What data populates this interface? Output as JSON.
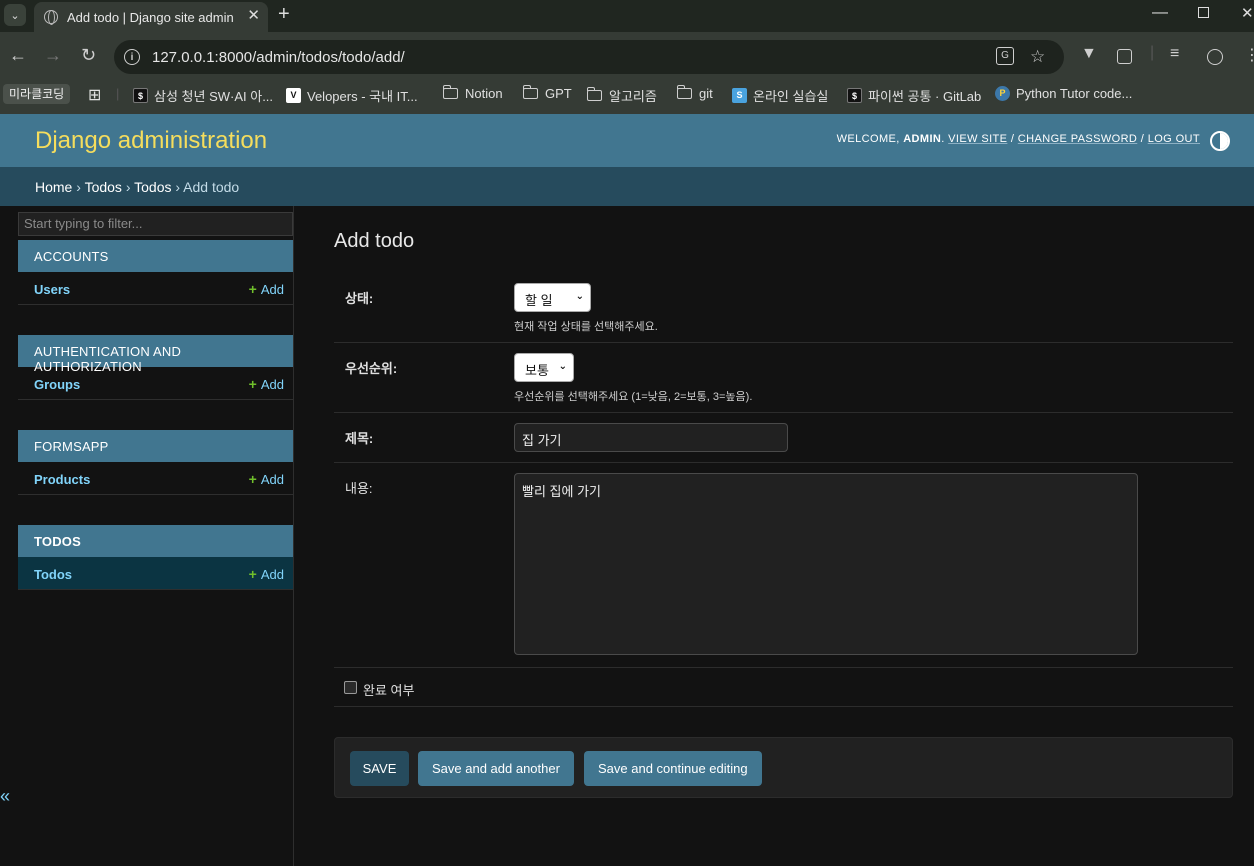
{
  "browser": {
    "tab_title": "Add todo | Django site admin",
    "url": "127.0.0.1:8000/admin/todos/todo/add/",
    "profile_chip": "미라클코딩",
    "bookmarks": [
      {
        "label": "삼성 청년 SW·AI 아...",
        "icon": "s-favicon"
      },
      {
        "label": "Velopers - 국내 IT...",
        "icon": "v-favicon"
      },
      {
        "label": "Notion",
        "icon": "folder-icon"
      },
      {
        "label": "GPT",
        "icon": "folder-icon"
      },
      {
        "label": "알고리즘",
        "icon": "folder-icon"
      },
      {
        "label": "git",
        "icon": "folder-icon"
      },
      {
        "label": "온라인 실습실",
        "icon": "s-favicon"
      },
      {
        "label": "파이썬 공통 · GitLab",
        "icon": "s-favicon"
      },
      {
        "label": "Python Tutor code...",
        "icon": "python-icon"
      }
    ]
  },
  "header": {
    "site_name": "Django administration",
    "welcome": "WELCOME,",
    "username": "ADMIN",
    "view_site": "VIEW SITE",
    "change_password": "CHANGE PASSWORD",
    "log_out": "LOG OUT",
    "separator": "/"
  },
  "breadcrumbs": {
    "home": "Home",
    "app": "Todos",
    "model": "Todos",
    "current": "Add todo",
    "sep": "›"
  },
  "sidebar": {
    "filter_placeholder": "Start typing to filter...",
    "add_label": "Add",
    "collapse_glyph": "«",
    "modules": [
      {
        "header": "ACCOUNTS",
        "model": "Users"
      },
      {
        "header": "AUTHENTICATION AND AUTHORIZATION",
        "model": "Groups"
      },
      {
        "header": "FORMSAPP",
        "model": "Products"
      },
      {
        "header": "TODOS",
        "model": "Todos",
        "current": true
      }
    ]
  },
  "form": {
    "title": "Add todo",
    "status": {
      "label": "상태:",
      "value": "할 일",
      "help": "현재 작업 상태를 선택해주세요."
    },
    "priority": {
      "label": "우선순위:",
      "value": "보통",
      "help": "우선순위를 선택해주세요 (1=낮음, 2=보통, 3=높음)."
    },
    "title_field": {
      "label": "제목:",
      "value": "집 가기"
    },
    "content": {
      "label": "내용:",
      "value": "빨리 집에 가기"
    },
    "completed": {
      "label": "완료 여부",
      "checked": false
    }
  },
  "buttons": {
    "save": "SAVE",
    "save_add_another": "Save and add another",
    "save_continue": "Save and continue editing"
  },
  "colors": {
    "header_bg": "#417690",
    "breadcrumb_bg": "#264b5d",
    "site_title": "#f5dd5d",
    "link": "#81d4fa",
    "add_plus": "#70bf2b"
  }
}
